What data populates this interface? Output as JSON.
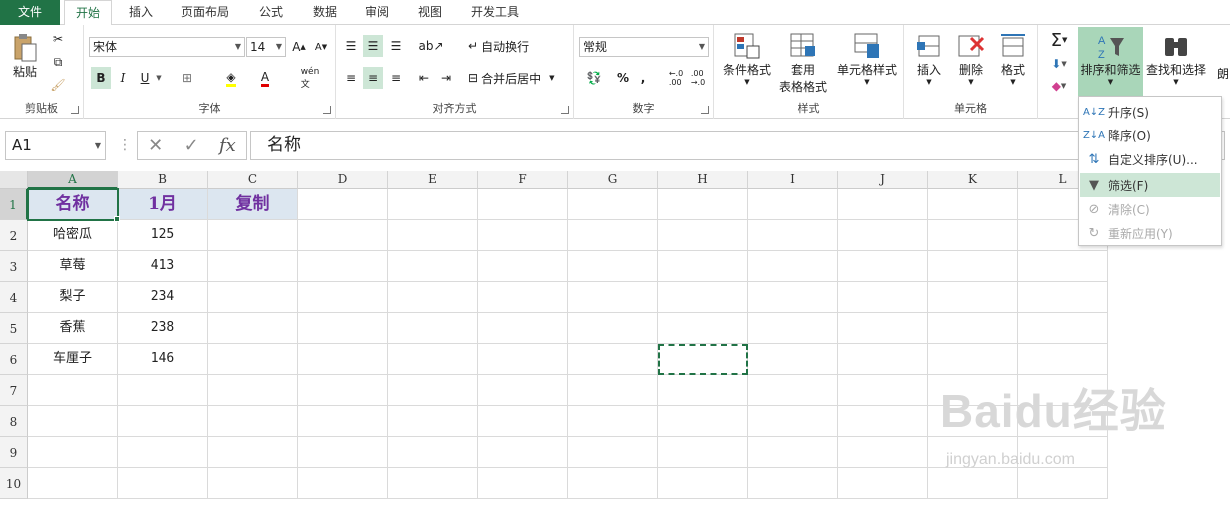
{
  "tabs": [
    "文件",
    "开始",
    "插入",
    "页面布局",
    "公式",
    "数据",
    "审阅",
    "视图",
    "开发工具"
  ],
  "groups": {
    "clipboard": {
      "label": "剪贴板",
      "paste": "粘贴"
    },
    "font": {
      "label": "字体",
      "font_name": "宋体",
      "font_size": "14",
      "bold": "B",
      "italic": "I",
      "underline": "U"
    },
    "alignment": {
      "label": "对齐方式",
      "wrap": "自动换行",
      "merge": "合并后居中"
    },
    "number": {
      "label": "数字",
      "format": "常规",
      "percent": "%",
      "comma": ","
    },
    "styles": {
      "label": "样式",
      "conditional": "条件格式",
      "table_format_line1": "套用",
      "table_format_line2": "表格格式",
      "cell_styles": "单元格样式"
    },
    "cells": {
      "label": "单元格",
      "insert": "插入",
      "delete": "删除",
      "format": "格式"
    },
    "editing": {
      "sort_filter": "排序和筛选",
      "find_select": "查找和选择",
      "more": "朗"
    }
  },
  "formula_bar": {
    "name_box": "A1",
    "formula": "名称",
    "fx": "fx"
  },
  "columns": [
    "A",
    "B",
    "C",
    "D",
    "E",
    "F",
    "G",
    "H",
    "I",
    "J",
    "K",
    "L"
  ],
  "rows": [
    "1",
    "2",
    "3",
    "4",
    "5",
    "6",
    "7",
    "8",
    "9",
    "10"
  ],
  "table": {
    "headers": [
      "名称",
      "1月",
      "复制"
    ],
    "data": [
      [
        "哈密瓜",
        "125"
      ],
      [
        "草莓",
        "413"
      ],
      [
        "梨子",
        "234"
      ],
      [
        "香蕉",
        "238"
      ],
      [
        "车厘子",
        "146"
      ]
    ]
  },
  "sort_menu": {
    "items": [
      "升序(S)",
      "降序(O)",
      "自定义排序(U)...",
      "筛选(F)",
      "清除(C)",
      "重新应用(Y)"
    ]
  },
  "watermark": {
    "brand": "Baidu经验",
    "url": "jingyan.baidu.com"
  },
  "colors": {
    "accent": "#217346",
    "header_fill": "#dce6f0",
    "header_text": "#7030a0"
  }
}
